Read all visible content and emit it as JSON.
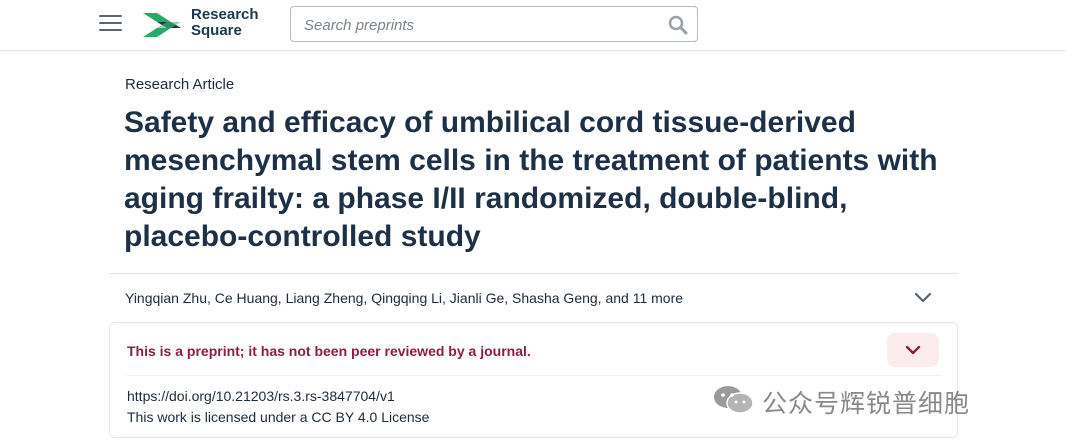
{
  "header": {
    "menu_icon": "hamburger-menu-icon",
    "logo": {
      "line1": "Research",
      "line2": "Square",
      "colors": {
        "green": "#2aa86a",
        "navy": "#1d3a4d"
      }
    },
    "search": {
      "placeholder": "Search preprints",
      "value": "",
      "icon": "search-icon"
    }
  },
  "article": {
    "type": "Research Article",
    "title": "Safety and efficacy of umbilical cord tissue-derived mesenchymal stem cells in the treatment of patients with aging frailty: a phase I/II randomized, double-blind, placebo-controlled study",
    "authors": "Yingqian Zhu, Ce Huang, Liang Zheng, Qingqing Li, Jianli Ge, Shasha Geng, and 11 more",
    "authors_toggle_icon": "chevron-down-icon"
  },
  "notice": {
    "text": "This is a preprint; it has not been peer reviewed by a journal.",
    "toggle_icon": "chevron-down-icon",
    "doi": "https://doi.org/10.21203/rs.3.rs-3847704/v1",
    "license": "This work is licensed under a CC BY 4.0 License",
    "accent_color": "#8c1f3c"
  },
  "watermark": {
    "text": "公众号辉锐普细胞",
    "icon": "wechat-icon"
  }
}
